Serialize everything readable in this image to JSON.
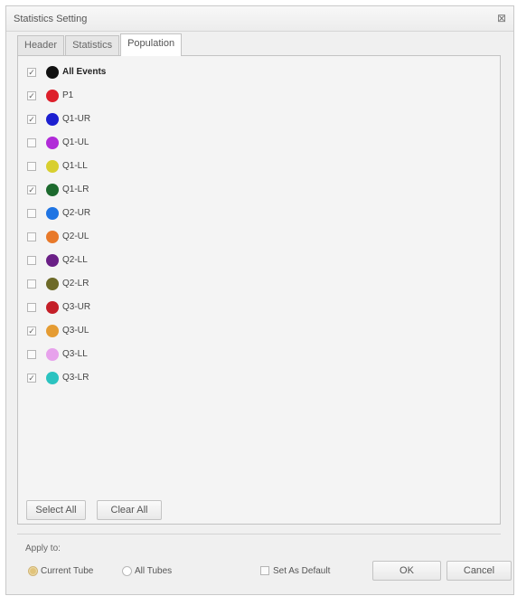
{
  "window": {
    "title": "Statistics Setting",
    "close_glyph": "⊠"
  },
  "tabs": [
    {
      "label": "Header",
      "active": false
    },
    {
      "label": "Statistics",
      "active": false
    },
    {
      "label": "Population",
      "active": true
    }
  ],
  "populations": [
    {
      "label": "All Events",
      "checked": true,
      "color": "#111111"
    },
    {
      "label": "P1",
      "checked": true,
      "color": "#dd1f2b"
    },
    {
      "label": "Q1-UR",
      "checked": true,
      "color": "#1c1fd0"
    },
    {
      "label": "Q1-UL",
      "checked": false,
      "color": "#b12bd8"
    },
    {
      "label": "Q1-LL",
      "checked": false,
      "color": "#d8cf2f"
    },
    {
      "label": "Q1-LR",
      "checked": true,
      "color": "#1d6a2e"
    },
    {
      "label": "Q2-UR",
      "checked": false,
      "color": "#1f74e3"
    },
    {
      "label": "Q2-UL",
      "checked": false,
      "color": "#e8792a"
    },
    {
      "label": "Q2-LL",
      "checked": false,
      "color": "#6a1f86"
    },
    {
      "label": "Q2-LR",
      "checked": false,
      "color": "#6d6a28"
    },
    {
      "label": "Q3-UR",
      "checked": false,
      "color": "#c41f28"
    },
    {
      "label": "Q3-UL",
      "checked": true,
      "color": "#e59c33"
    },
    {
      "label": "Q3-LL",
      "checked": false,
      "color": "#e7a2ec"
    },
    {
      "label": "Q3-LR",
      "checked": true,
      "color": "#2bc3c0"
    }
  ],
  "panel_buttons": {
    "select_all": "Select All",
    "clear_all": "Clear All"
  },
  "apply": {
    "label": "Apply to:",
    "current_tube": "Current Tube",
    "all_tubes": "All Tubes",
    "selected": "current_tube"
  },
  "footer": {
    "set_default": "Set As Default",
    "set_default_checked": false,
    "ok": "OK",
    "cancel": "Cancel"
  }
}
